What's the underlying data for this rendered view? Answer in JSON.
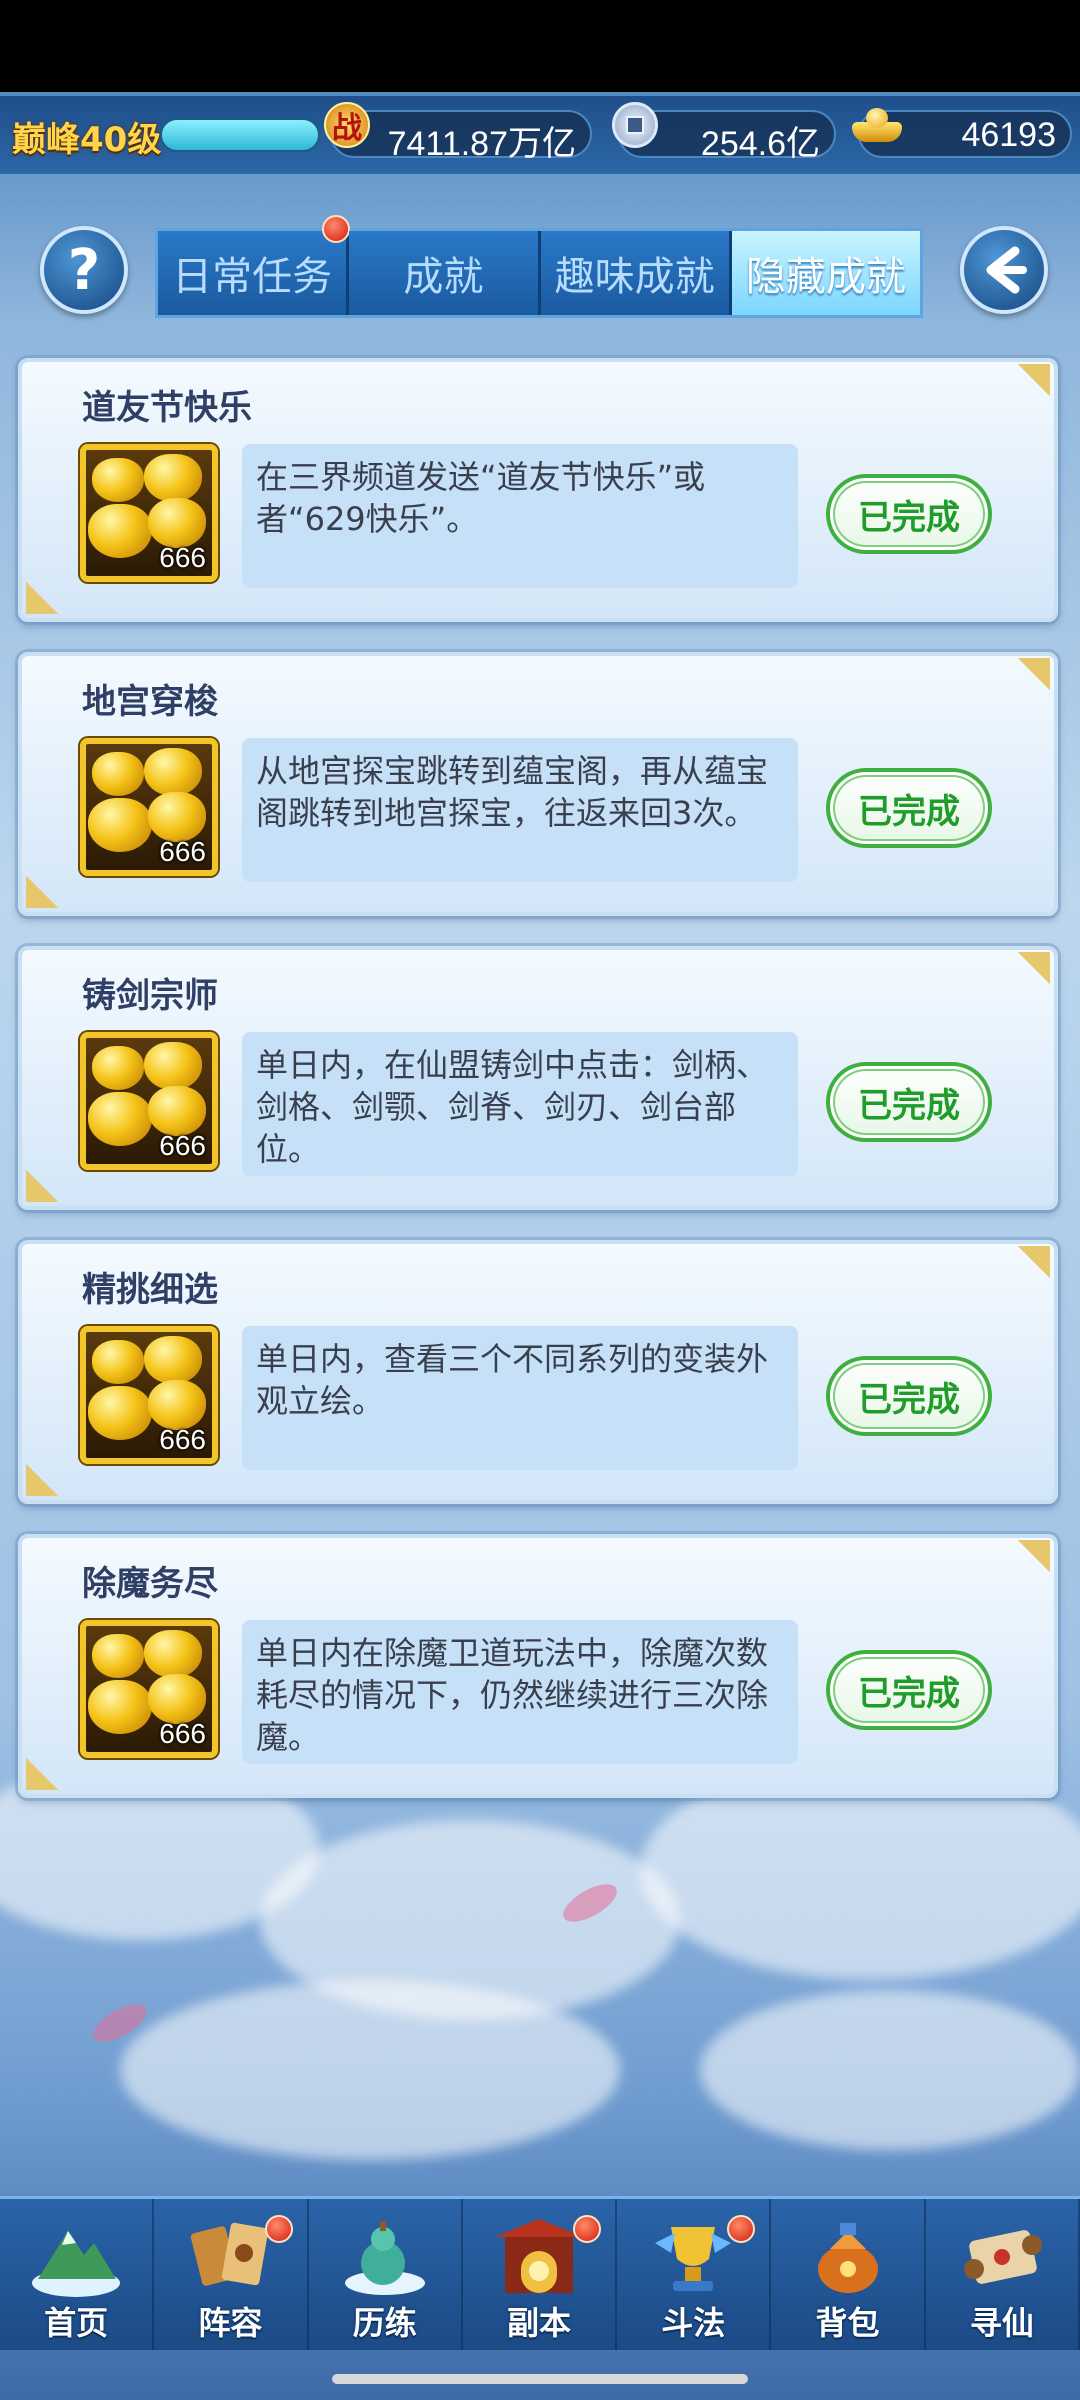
{
  "header": {
    "level": "巅峰40级",
    "combat_power": "7411.87万亿",
    "silver": "254.6亿",
    "gold": "46193"
  },
  "icons": {
    "power": "战",
    "help": "?"
  },
  "tabs": [
    {
      "label": "日常任务",
      "badge": true,
      "active": false
    },
    {
      "label": "成就",
      "badge": false,
      "active": false
    },
    {
      "label": "趣味成就",
      "badge": false,
      "active": false
    },
    {
      "label": "隐藏成就",
      "badge": false,
      "active": true
    }
  ],
  "achievements": [
    {
      "title": "道友节快乐",
      "reward_count": "666",
      "description": "在三界频道发送“道友节快乐”或者“629快乐”。",
      "status": "已完成"
    },
    {
      "title": "地宫穿梭",
      "reward_count": "666",
      "description": "从地宫探宝跳转到蕴宝阁，再从蕴宝阁跳转到地宫探宝，往返来回3次。",
      "status": "已完成"
    },
    {
      "title": "铸剑宗师",
      "reward_count": "666",
      "description": "单日内，在仙盟铸剑中点击：剑柄、剑格、剑颚、剑脊、剑刃、剑台部位。",
      "status": "已完成"
    },
    {
      "title": "精挑细选",
      "reward_count": "666",
      "description": "单日内，查看三个不同系列的变装外观立绘。",
      "status": "已完成"
    },
    {
      "title": "除魔务尽",
      "reward_count": "666",
      "description": "单日内在除魔卫道玩法中，除魔次数耗尽的情况下，仍然继续进行三次除魔。",
      "status": "已完成"
    }
  ],
  "bottom_nav": [
    {
      "label": "首页",
      "badge": false
    },
    {
      "label": "阵容",
      "badge": true
    },
    {
      "label": "历练",
      "badge": false
    },
    {
      "label": "副本",
      "badge": true
    },
    {
      "label": "斗法",
      "badge": true
    },
    {
      "label": "背包",
      "badge": false
    },
    {
      "label": "寻仙",
      "badge": false
    }
  ],
  "colors": {
    "complete_green": "#1f9c2a",
    "badge_red": "#d21c0a",
    "gold_border": "#f2c52a"
  }
}
